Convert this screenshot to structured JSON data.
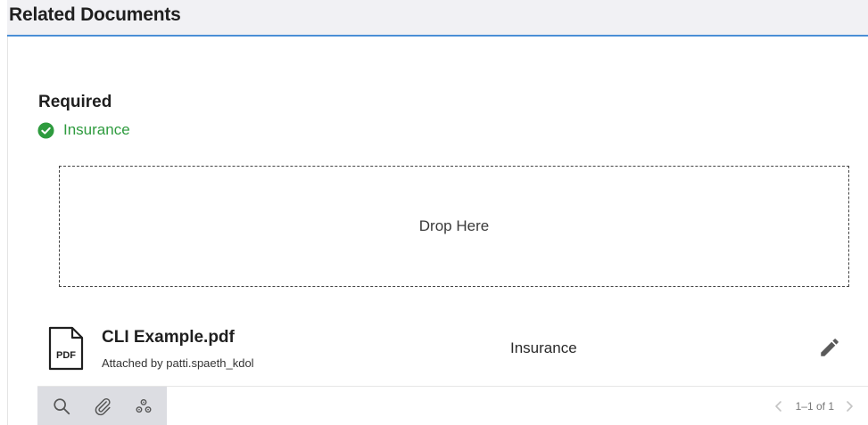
{
  "header": {
    "title": "Related Documents"
  },
  "required": {
    "label": "Required",
    "items": [
      {
        "label": "Insurance",
        "status": "complete",
        "icon": "check-circle-icon",
        "color": "#2e9b3e"
      }
    ]
  },
  "dropzone": {
    "label": "Drop Here"
  },
  "documents": [
    {
      "icon": "pdf-file-icon",
      "icon_text": "PDF",
      "name": "CLI Example.pdf",
      "meta": "Attached by patti.spaeth_kdol",
      "category": "Insurance",
      "action_icon": "pencil-icon"
    }
  ],
  "toolbar": {
    "icons": [
      "search-icon",
      "paperclip-icon",
      "settings-cluster-icon"
    ]
  },
  "pagination": {
    "label": "1–1 of 1",
    "prev_icon": "chevron-left-icon",
    "next_icon": "chevron-right-icon"
  },
  "colors": {
    "accent": "#4a8fd6",
    "success": "#2e9b3e",
    "header_bg": "#f1f1f4",
    "toolbar_bg": "#dcdde2"
  }
}
